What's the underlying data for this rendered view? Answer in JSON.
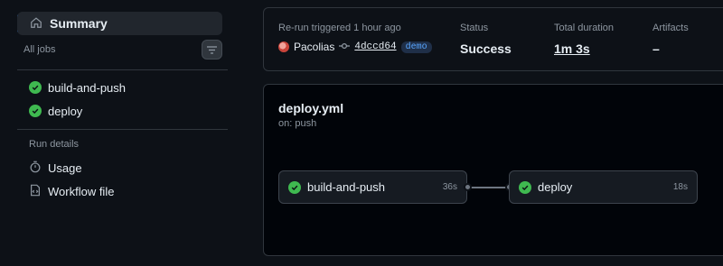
{
  "sidebar": {
    "summary_label": "Summary",
    "all_jobs_label": "All jobs",
    "jobs": [
      {
        "label": "build-and-push",
        "status": "success"
      },
      {
        "label": "deploy",
        "status": "success"
      }
    ],
    "run_details_label": "Run details",
    "run_items": [
      {
        "label": "Usage",
        "icon": "stopwatch-icon"
      },
      {
        "label": "Workflow file",
        "icon": "file-code-icon"
      }
    ]
  },
  "info": {
    "trigger_label": "Re-run triggered 1 hour ago",
    "actor": "Pacolias",
    "commit": "4dccd64",
    "branch": "demo",
    "status_label": "Status",
    "status_value": "Success",
    "duration_label": "Total duration",
    "duration_value": "1m 3s",
    "artifacts_label": "Artifacts",
    "artifacts_value": "–"
  },
  "workflow": {
    "file": "deploy.yml",
    "trigger": "on: push",
    "nodes": [
      {
        "name": "build-and-push",
        "time": "36s"
      },
      {
        "name": "deploy",
        "time": "18s"
      }
    ]
  },
  "colors": {
    "success": "#3fb950",
    "accent": "#2f81f7",
    "background": "#0d1117"
  }
}
